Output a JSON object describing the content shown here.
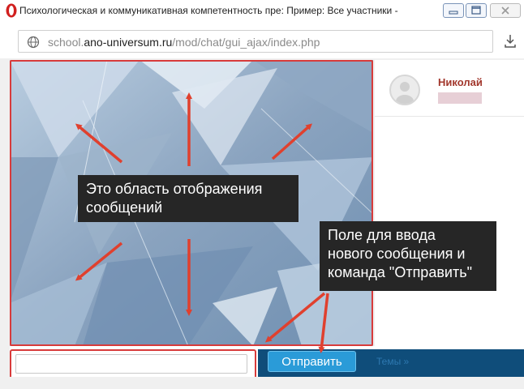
{
  "browser": {
    "window_title": "Психологическая и коммуникативная компетентность пре: Пример: Все участники -",
    "url_prefix": "school.",
    "url_domain": "ano-universum.ru",
    "url_path": "/mod/chat/gui_ajax/index.php",
    "icons": [
      "opera-logo-icon",
      "minimize-icon",
      "maximize-icon",
      "close-icon",
      "globe-icon",
      "download-icon"
    ]
  },
  "chat": {
    "users": [
      {
        "name": "Николай"
      }
    ],
    "message_input": {
      "value": "",
      "placeholder": ""
    },
    "send_label": "Отправить",
    "topics_label": "Темы »"
  },
  "annotations": {
    "messages_area_line1": "Это область отображения",
    "messages_area_line2": "сообщений",
    "input_line1": "Поле для ввода",
    "input_line2": "нового сообщения и",
    "input_line3": "команда \"Отправить\""
  },
  "colors": {
    "annotation_red": "#d83b3b",
    "send_button": "#2a9bd8",
    "nav_strip": "#0f4d7a",
    "username": "#a2372c"
  }
}
